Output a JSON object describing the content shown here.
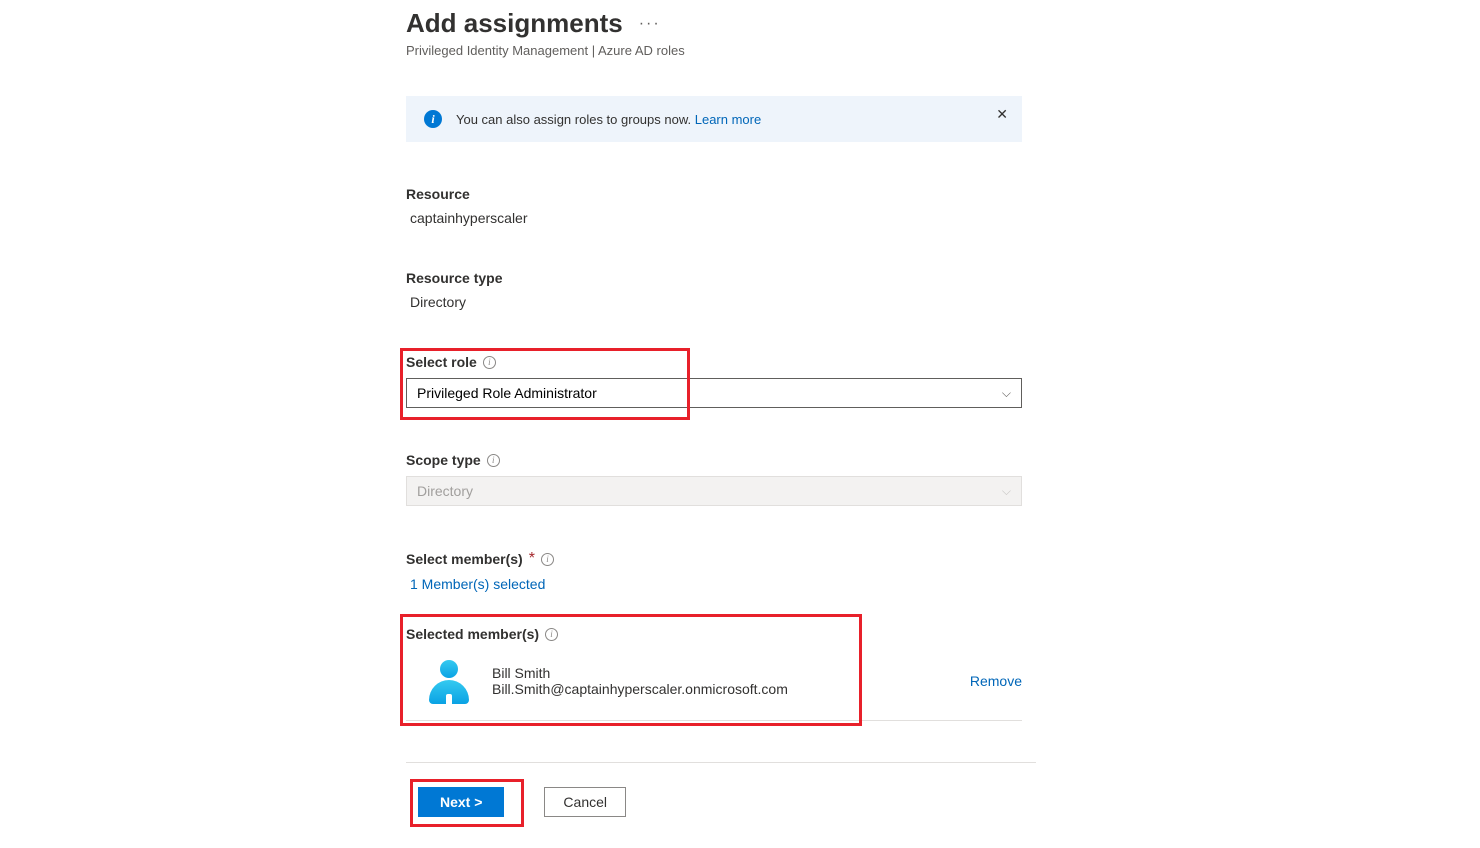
{
  "header": {
    "title": "Add assignments",
    "subtitle": "Privileged Identity Management | Azure AD roles",
    "more": "···"
  },
  "banner": {
    "text": "You can also assign roles to groups now. ",
    "link": "Learn more",
    "close": "✕"
  },
  "resource": {
    "label": "Resource",
    "value": "captainhyperscaler"
  },
  "resource_type": {
    "label": "Resource type",
    "value": "Directory"
  },
  "select_role": {
    "label": "Select role",
    "value": "Privileged Role Administrator"
  },
  "scope_type": {
    "label": "Scope type",
    "value": "Directory"
  },
  "select_members": {
    "label": "Select member(s)",
    "link": "1 Member(s) selected"
  },
  "selected_members": {
    "label": "Selected member(s)",
    "member": {
      "name": "Bill Smith",
      "email": "Bill.Smith@captainhyperscaler.onmicrosoft.com",
      "remove": "Remove"
    }
  },
  "footer": {
    "next": "Next >",
    "cancel": "Cancel"
  }
}
